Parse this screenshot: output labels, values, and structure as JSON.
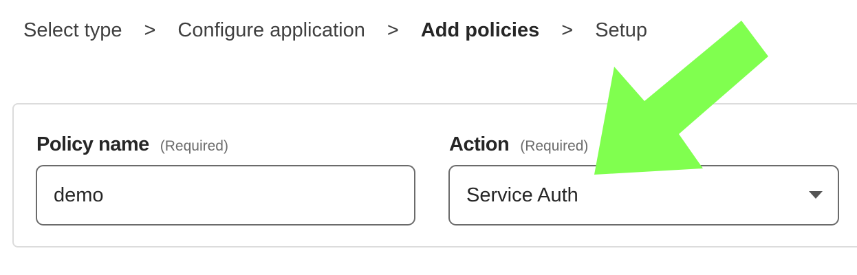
{
  "breadcrumb": {
    "steps": [
      {
        "label": "Select type",
        "current": false
      },
      {
        "label": "Configure application",
        "current": false
      },
      {
        "label": "Add policies",
        "current": true
      },
      {
        "label": "Setup",
        "current": false
      }
    ],
    "separator": ">"
  },
  "form": {
    "policy_name": {
      "label": "Policy name",
      "required_text": "(Required)",
      "value": "demo"
    },
    "action": {
      "label": "Action",
      "required_text": "(Required)",
      "selected_value": "Service Auth"
    }
  },
  "annotation": {
    "arrow_color": "#80ff4f"
  }
}
